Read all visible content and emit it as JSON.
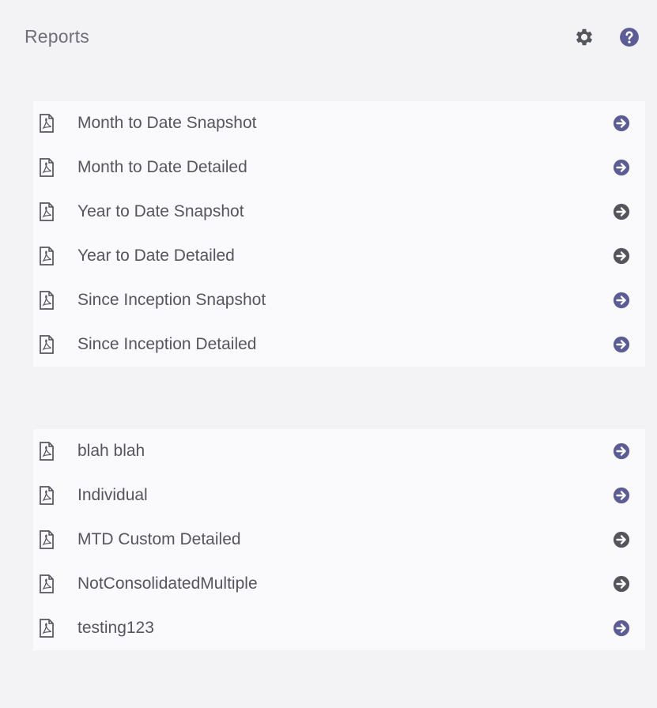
{
  "header": {
    "title": "Reports",
    "settings_icon": "gear-icon",
    "help_icon": "help-icon"
  },
  "colors": {
    "background": "#f3f3f6",
    "card": "#fafafc",
    "text": "#55555e",
    "accent": "#5c5c96",
    "icon": "#55555e"
  },
  "standard_reports": [
    {
      "label": "Month to Date Snapshot",
      "icon": "pdf-document-icon",
      "action_icon": "arrow-circle-right-icon"
    },
    {
      "label": "Month to Date Detailed",
      "icon": "pdf-document-icon",
      "action_icon": "arrow-circle-right-icon"
    },
    {
      "label": "Year to Date Snapshot",
      "icon": "pdf-document-icon",
      "action_icon": "arrow-circle-right-icon"
    },
    {
      "label": "Year to Date Detailed",
      "icon": "pdf-document-icon",
      "action_icon": "arrow-circle-right-icon"
    },
    {
      "label": "Since Inception Snapshot",
      "icon": "pdf-document-icon",
      "action_icon": "arrow-circle-right-icon"
    },
    {
      "label": "Since Inception Detailed",
      "icon": "pdf-document-icon",
      "action_icon": "arrow-circle-right-icon"
    }
  ],
  "custom_reports": [
    {
      "label": "blah blah",
      "icon": "pdf-document-icon",
      "action_icon": "arrow-circle-right-icon"
    },
    {
      "label": "Individual",
      "icon": "pdf-document-icon",
      "action_icon": "arrow-circle-right-icon"
    },
    {
      "label": "MTD Custom Detailed",
      "icon": "pdf-document-icon",
      "action_icon": "arrow-circle-right-icon"
    },
    {
      "label": "NotConsolidatedMultiple",
      "icon": "pdf-document-icon",
      "action_icon": "arrow-circle-right-icon"
    },
    {
      "label": "testing123",
      "icon": "pdf-document-icon",
      "action_icon": "arrow-circle-right-icon"
    }
  ]
}
